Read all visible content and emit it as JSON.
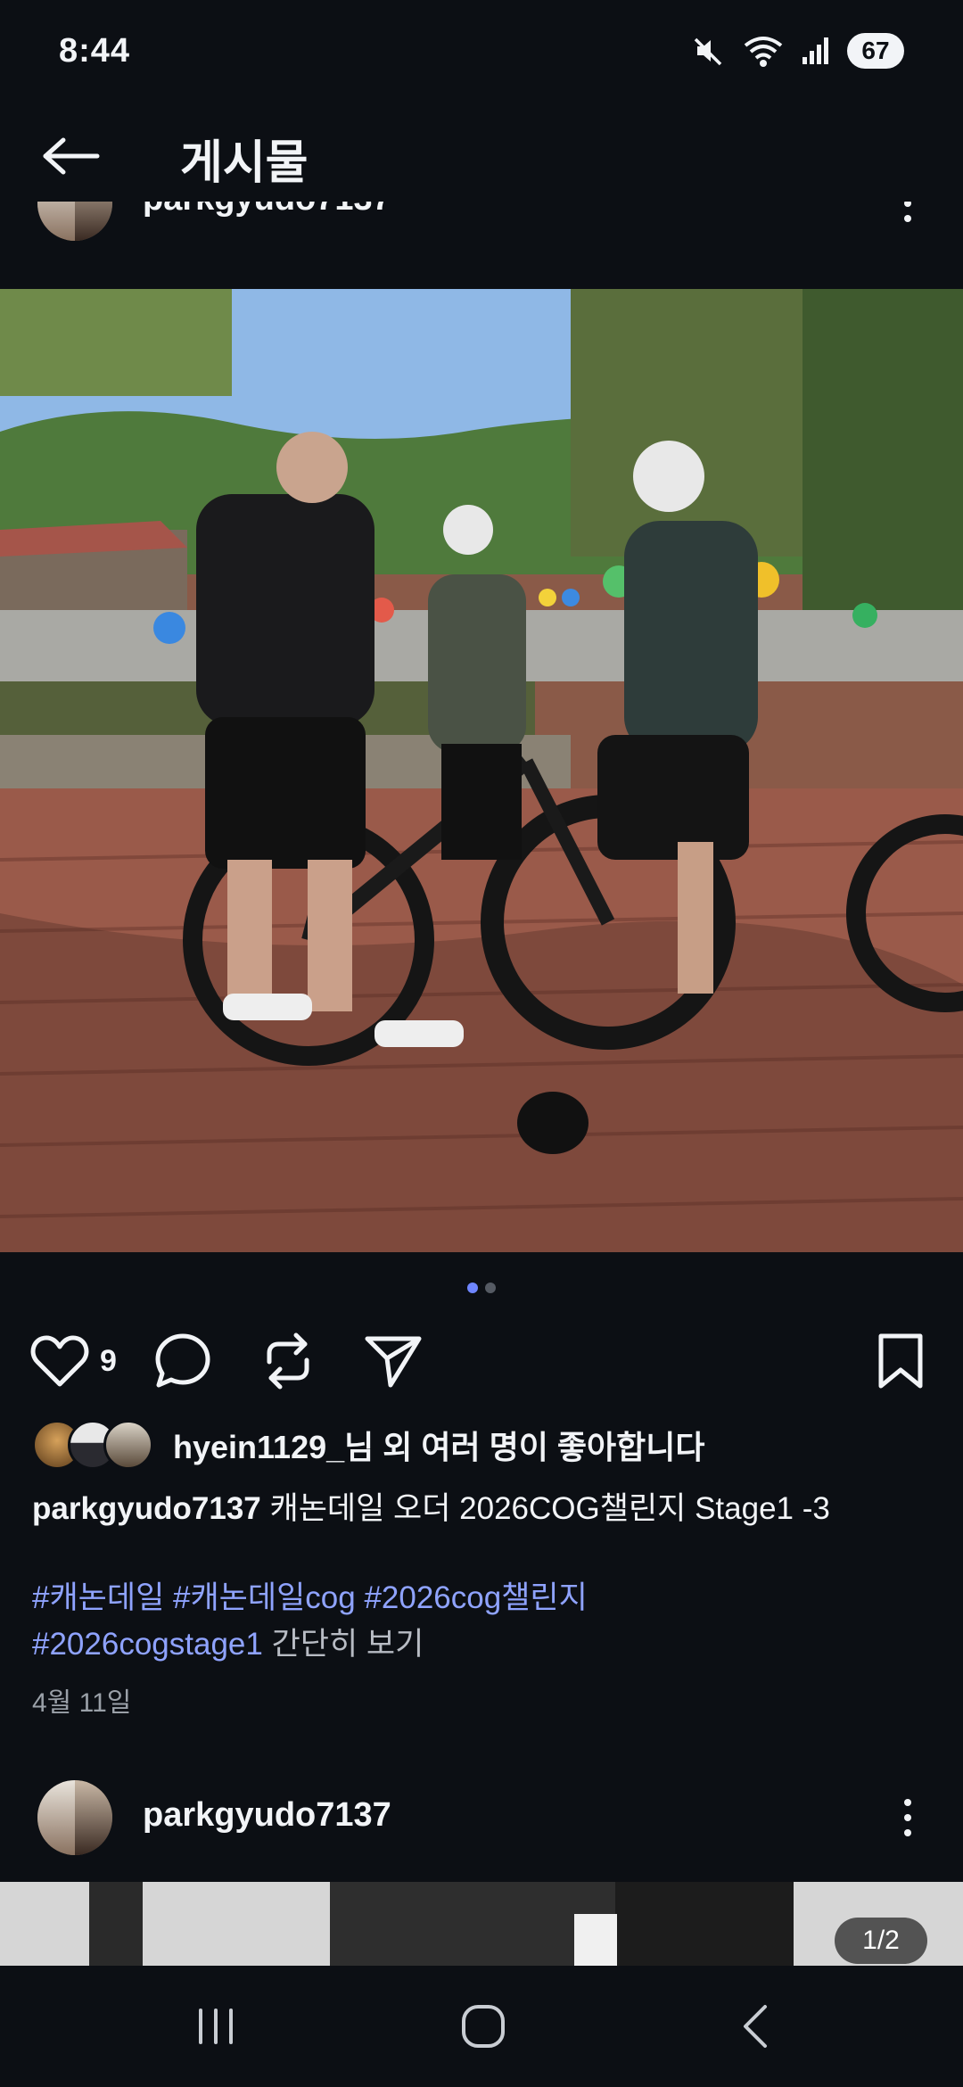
{
  "status_bar": {
    "time": "8:44",
    "battery": "67",
    "icons": [
      "mute-icon",
      "wifi-icon",
      "signal-icon",
      "battery-icon"
    ]
  },
  "header": {
    "title": "게시물",
    "back_icon": "arrow-left-icon"
  },
  "post": {
    "author": "parkgyudo7137",
    "image_count": 2,
    "current_image": 1,
    "like_count": "9",
    "likes_text": "hyein1129_님 외 여러 명이 좋아합니다",
    "caption_user": "parkgyudo7137",
    "caption_text": " 캐논데일 오더 2026COG챌린지 Stage1 -3",
    "hashtags": [
      "#캐논데일",
      "#캐논데일cog",
      "#2026cog챌린지",
      "#2026cogstage1"
    ],
    "more_label": "간단히 보기",
    "date": "4월 11일"
  },
  "next_post": {
    "author": "parkgyudo7137",
    "counter": "1/2"
  },
  "colors": {
    "background": "#0c0f14",
    "text": "#f2f4f7",
    "hashtag": "#8fa3ff",
    "dot_active": "#6f86ff"
  }
}
